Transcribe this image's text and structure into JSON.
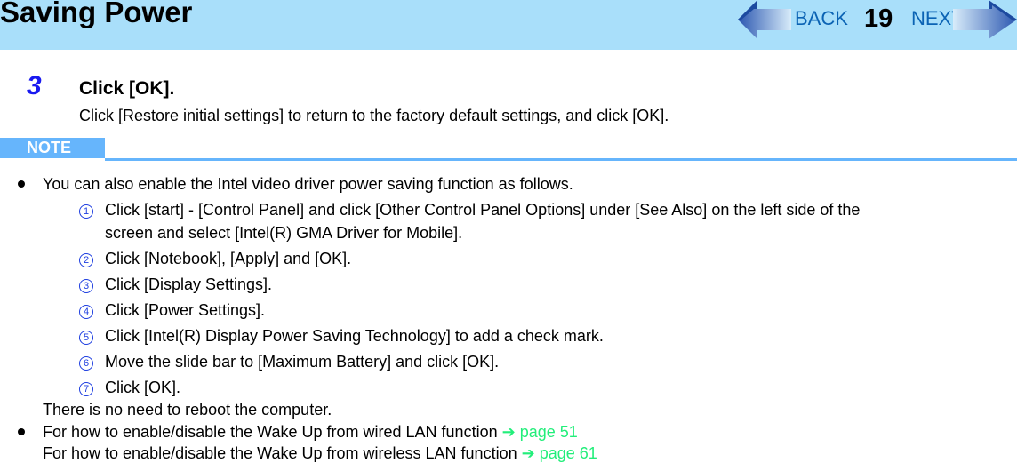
{
  "header": {
    "title": "Saving Power",
    "nav": {
      "back_label": "BACK",
      "page_number": "19",
      "next_label": "NEXT"
    }
  },
  "step": {
    "number": "3",
    "title": "Click [OK].",
    "description": "Click [Restore initial settings] to return to the factory default settings, and click [OK]."
  },
  "note": {
    "label": "NOTE",
    "bullets": [
      {
        "text": "You can also enable the Intel video driver power saving function as follows.",
        "substeps": [
          {
            "marker": "1",
            "lines": [
              "Click [start] - [Control Panel] and click [Other Control Panel Options] under [See Also] on the left side of the",
              "screen and select [Intel(R) GMA Driver for Mobile]."
            ]
          },
          {
            "marker": "2",
            "lines": [
              "Click [Notebook], [Apply] and [OK]."
            ]
          },
          {
            "marker": "3",
            "lines": [
              "Click [Display Settings]."
            ]
          },
          {
            "marker": "4",
            "lines": [
              "Click [Power Settings]."
            ]
          },
          {
            "marker": "5",
            "lines": [
              "Click [Intel(R) Display Power Saving Technology] to add a check mark."
            ]
          },
          {
            "marker": "6",
            "lines": [
              "Move the slide bar to [Maximum Battery] and click [OK]."
            ]
          },
          {
            "marker": "7",
            "lines": [
              "Click [OK]."
            ]
          }
        ],
        "after": "There is no need to reboot the computer."
      },
      {
        "line1": {
          "text": "For how to enable/disable the Wake Up from wired LAN function",
          "arrow": "➔",
          "link": "page 51"
        },
        "line2": {
          "text": "For how to enable/disable the Wake Up from wireless LAN function",
          "arrow": "➔",
          "link": "page 61"
        }
      }
    ]
  }
}
